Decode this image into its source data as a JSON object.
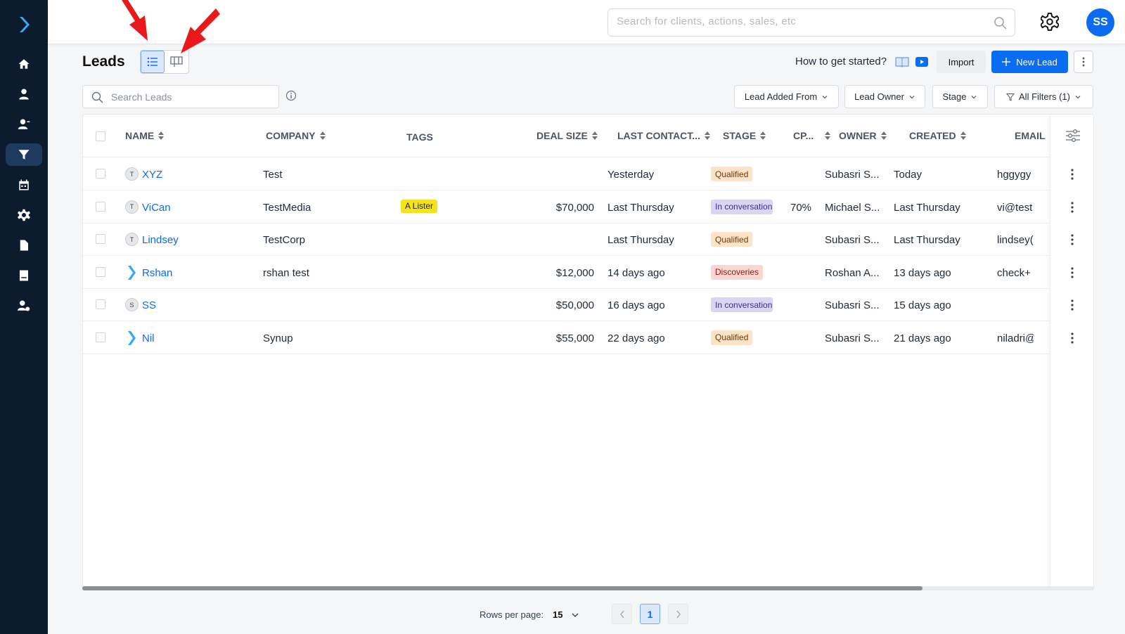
{
  "header": {
    "search_placeholder": "Search for clients, actions, sales, etc",
    "avatar_initials": "SS"
  },
  "page": {
    "title": "Leads",
    "howto_label": "How to get started?",
    "import_label": "Import",
    "new_lead_label": "New Lead"
  },
  "filters": {
    "search_placeholder": "Search Leads",
    "lead_added_from": "Lead Added From",
    "lead_owner": "Lead Owner",
    "stage": "Stage",
    "all_filters": "All Filters (1)"
  },
  "table": {
    "columns": {
      "name": "NAME",
      "company": "COMPANY",
      "tags": "TAGS",
      "deal_size": "DEAL SIZE",
      "last_contact": "LAST CONTACT...",
      "stage": "STAGE",
      "cp": "CP...",
      "owner": "OWNER",
      "created": "CREATED",
      "email": "EMAIL"
    },
    "rows": [
      {
        "initial": "T",
        "name": "XYZ",
        "company": "Test",
        "tag": "",
        "deal": "",
        "last": "Yesterday",
        "stage": "Qualified",
        "cp": "",
        "owner": "Subasri S...",
        "created": "Today",
        "email": "hggygy"
      },
      {
        "initial": "T",
        "name": "ViCan",
        "company": "TestMedia",
        "tag": "A Lister",
        "deal": "$70,000",
        "last": "Last Thursday",
        "stage": "In conversation",
        "cp": "70%",
        "owner": "Michael S...",
        "created": "Last Thursday",
        "email": "vi@test"
      },
      {
        "initial": "T",
        "name": "Lindsey",
        "company": "TestCorp",
        "tag": "",
        "deal": "",
        "last": "Last Thursday",
        "stage": "Qualified",
        "cp": "",
        "owner": "Subasri S...",
        "created": "Last Thursday",
        "email": "lindsey("
      },
      {
        "initial": "",
        "name": "Rshan",
        "company": "rshan test",
        "tag": "",
        "deal": "$12,000",
        "last": "14 days ago",
        "stage": "Discoveries",
        "cp": "",
        "owner": "Roshan A...",
        "created": "13 days ago",
        "email": "check+"
      },
      {
        "initial": "S",
        "name": "SS",
        "company": "",
        "tag": "",
        "deal": "$50,000",
        "last": "16 days ago",
        "stage": "In conversation",
        "cp": "",
        "owner": "Subasri S...",
        "created": "15 days ago",
        "email": ""
      },
      {
        "initial": "",
        "name": "Nil",
        "company": "Synup",
        "tag": "",
        "deal": "$55,000",
        "last": "22 days ago",
        "stage": "Qualified",
        "cp": "",
        "owner": "Subasri S...",
        "created": "21 days ago",
        "email": "niladri@"
      }
    ]
  },
  "pagination": {
    "rows_per_page_label": "Rows per page:",
    "rows_per_page": "15",
    "current_page": "1"
  },
  "colors": {
    "sidebar": "#0c1b2e",
    "accent": "#0a6cf0",
    "qualified_bg": "#fde3c7",
    "conversation_bg": "#d9d5f3",
    "discoveries_bg": "#fbd5d0",
    "tag_bg": "#f5e21b",
    "annotation_arrow": "#e8181b"
  }
}
